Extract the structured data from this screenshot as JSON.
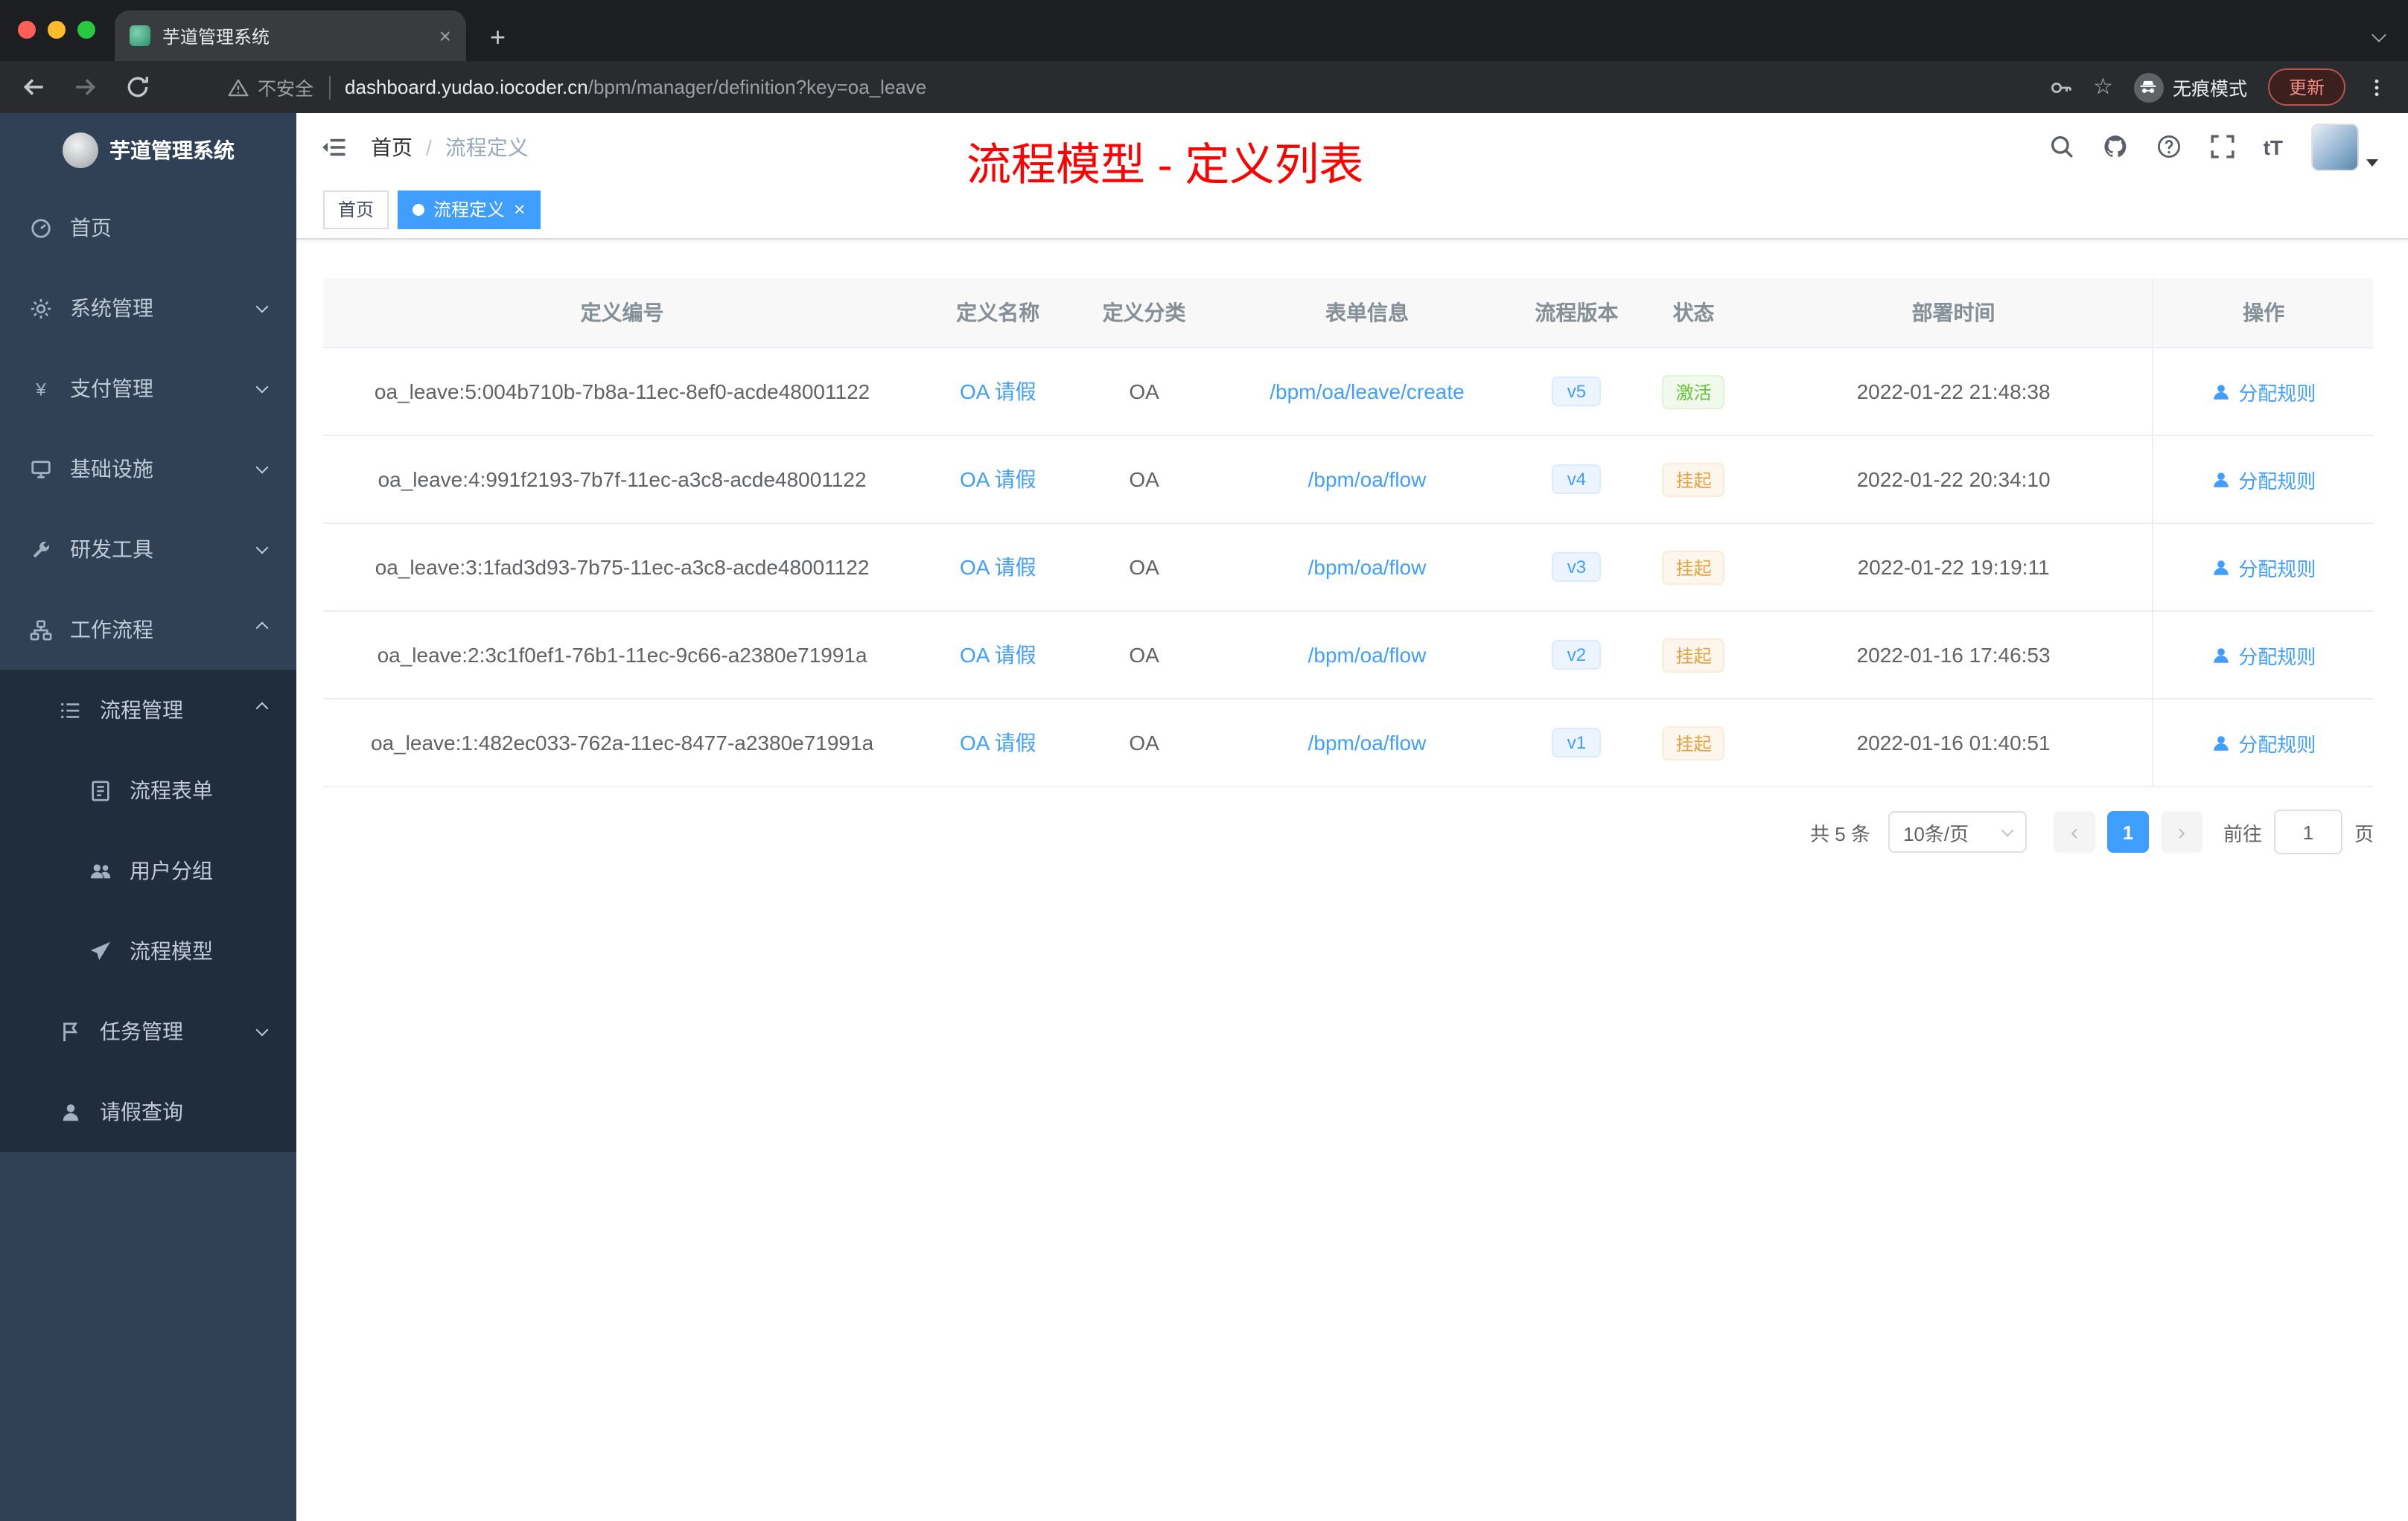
{
  "browser": {
    "tab": {
      "title": "芋道管理系统"
    },
    "address": {
      "security_label": "不安全",
      "host": "dashboard.yudao.iocoder.cn",
      "path": "/bpm/manager/definition?key=oa_leave"
    },
    "incognito_label": "无痕模式",
    "update_button": "更新"
  },
  "icons": {
    "close_glyph": "×",
    "new_tab_glyph": "+",
    "star_glyph": "☆",
    "prev_glyph": "‹",
    "next_glyph": "›",
    "fontsize_glyph": "tT"
  },
  "sidebar": {
    "app_title": "芋道管理系统",
    "items": [
      {
        "key": "home",
        "label": "首页",
        "icon": "dashboard-icon",
        "level": 1
      },
      {
        "key": "system-mgmt",
        "label": "系统管理",
        "icon": "gear-icon",
        "level": 1,
        "chevron": "down"
      },
      {
        "key": "payment-mgmt",
        "label": "支付管理",
        "icon": "yen-icon",
        "level": 1,
        "chevron": "down"
      },
      {
        "key": "infrastructure",
        "label": "基础设施",
        "icon": "monitor-icon",
        "level": 1,
        "chevron": "down"
      },
      {
        "key": "dev-tools",
        "label": "研发工具",
        "icon": "wrench-icon",
        "level": 1,
        "chevron": "down"
      },
      {
        "key": "workflow",
        "label": "工作流程",
        "icon": "workflow-icon",
        "level": 1,
        "chevron": "up"
      },
      {
        "key": "process-mgmt",
        "label": "流程管理",
        "icon": "list-icon",
        "level": 2,
        "chevron": "up",
        "dark": true
      },
      {
        "key": "process-form",
        "label": "流程表单",
        "icon": "form-icon",
        "level": 3,
        "dark": true
      },
      {
        "key": "user-group",
        "label": "用户分组",
        "icon": "users-icon",
        "level": 3,
        "dark": true
      },
      {
        "key": "process-model",
        "label": "流程模型",
        "icon": "paper-plane-icon",
        "level": 3,
        "dark": true
      },
      {
        "key": "task-mgmt",
        "label": "任务管理",
        "icon": "flag-icon",
        "level": 2,
        "chevron": "down",
        "dark": true
      },
      {
        "key": "leave-query",
        "label": "请假查询",
        "icon": "user-icon",
        "level": 2,
        "dark": true
      }
    ]
  },
  "navbar": {
    "breadcrumb": {
      "home": "首页",
      "separator": "/",
      "current": "流程定义"
    }
  },
  "annotation": {
    "text": "流程模型 - 定义列表",
    "color": "#ff0000"
  },
  "tags": [
    {
      "label": "首页",
      "active": false,
      "closable": false
    },
    {
      "label": "流程定义",
      "active": true,
      "closable": true
    }
  ],
  "table": {
    "columns": [
      "定义编号",
      "定义名称",
      "定义分类",
      "表单信息",
      "流程版本",
      "状态",
      "部署时间",
      "操作"
    ],
    "action_label": "分配规则",
    "rows": [
      {
        "id": "oa_leave:5:004b710b-7b8a-11ec-8ef0-acde48001122",
        "name": "OA 请假",
        "category": "OA",
        "form": "/bpm/oa/leave/create",
        "version": "v5",
        "status": "激活",
        "status_type": "success",
        "time": "2022-01-22 21:48:38"
      },
      {
        "id": "oa_leave:4:991f2193-7b7f-11ec-a3c8-acde48001122",
        "name": "OA 请假",
        "category": "OA",
        "form": "/bpm/oa/flow",
        "version": "v4",
        "status": "挂起",
        "status_type": "warning",
        "time": "2022-01-22 20:34:10"
      },
      {
        "id": "oa_leave:3:1fad3d93-7b75-11ec-a3c8-acde48001122",
        "name": "OA 请假",
        "category": "OA",
        "form": "/bpm/oa/flow",
        "version": "v3",
        "status": "挂起",
        "status_type": "warning",
        "time": "2022-01-22 19:19:11"
      },
      {
        "id": "oa_leave:2:3c1f0ef1-76b1-11ec-9c66-a2380e71991a",
        "name": "OA 请假",
        "category": "OA",
        "form": "/bpm/oa/flow",
        "version": "v2",
        "status": "挂起",
        "status_type": "warning",
        "time": "2022-01-16 17:46:53"
      },
      {
        "id": "oa_leave:1:482ec033-762a-11ec-8477-a2380e71991a",
        "name": "OA 请假",
        "category": "OA",
        "form": "/bpm/oa/flow",
        "version": "v1",
        "status": "挂起",
        "status_type": "warning",
        "time": "2022-01-16 01:40:51"
      }
    ]
  },
  "pagination": {
    "total": "共 5 条",
    "page_size": "10条/页",
    "current_page": "1",
    "goto_label": "前往",
    "goto_value": "1",
    "unit_label": "页"
  },
  "colors": {
    "accent": "#409eff",
    "success": "#67c23a",
    "warning": "#e6a23c",
    "sidebar_bg": "#304156",
    "sidebar_sub_bg": "#1f2d3d",
    "annotation_red": "#ff0000"
  }
}
